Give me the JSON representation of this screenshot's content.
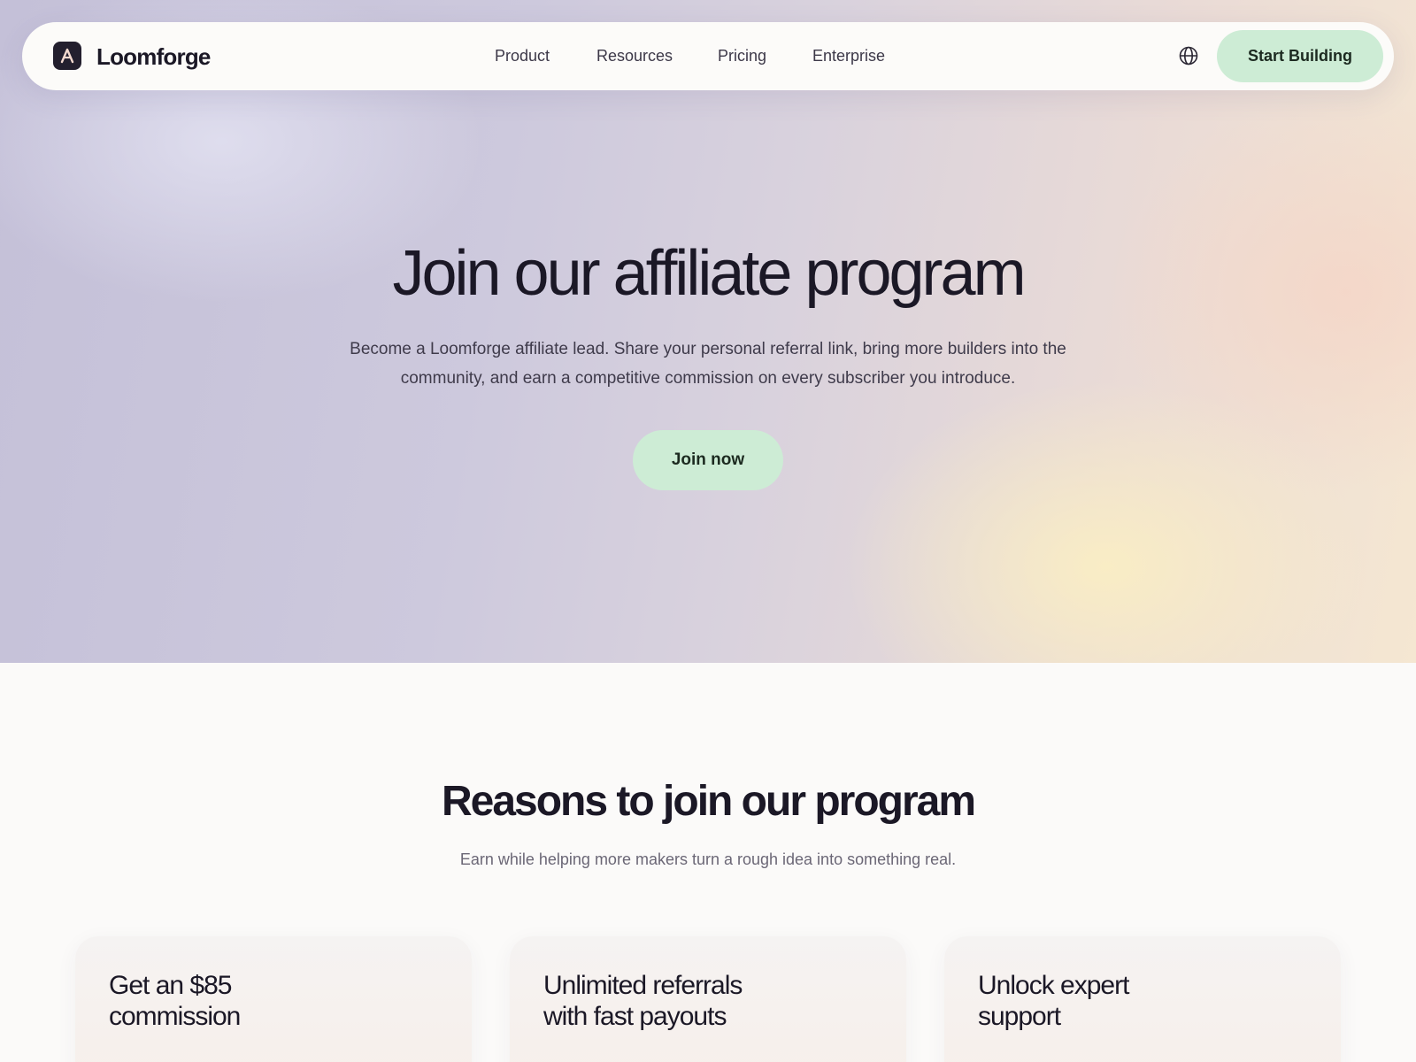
{
  "nav": {
    "brand": "Loomforge",
    "links": [
      "Product",
      "Resources",
      "Pricing",
      "Enterprise"
    ],
    "globe_icon": "globe-icon",
    "cta_label": "Start Building"
  },
  "hero": {
    "title": "Join our affiliate program",
    "subtitle_line1": "Become a Loomforge affiliate lead. Share your personal referral link, bring more builders into the",
    "subtitle_line2": "community, and earn a competitive commission on every subscriber you introduce.",
    "cta_label": "Join now"
  },
  "reasons": {
    "title": "Reasons to join our program",
    "subtitle": "Earn while helping more makers turn a rough idea into something real.",
    "cards": [
      {
        "line1": "Get an $85",
        "line2": "commission"
      },
      {
        "line1": "Unlimited referrals",
        "line2": "with fast payouts"
      },
      {
        "line1": "Unlock expert",
        "line2": "support"
      }
    ]
  },
  "colors": {
    "accent_green": "#cdecd5",
    "text_dark": "#1b1826",
    "logo_bg": "#231f2e"
  }
}
